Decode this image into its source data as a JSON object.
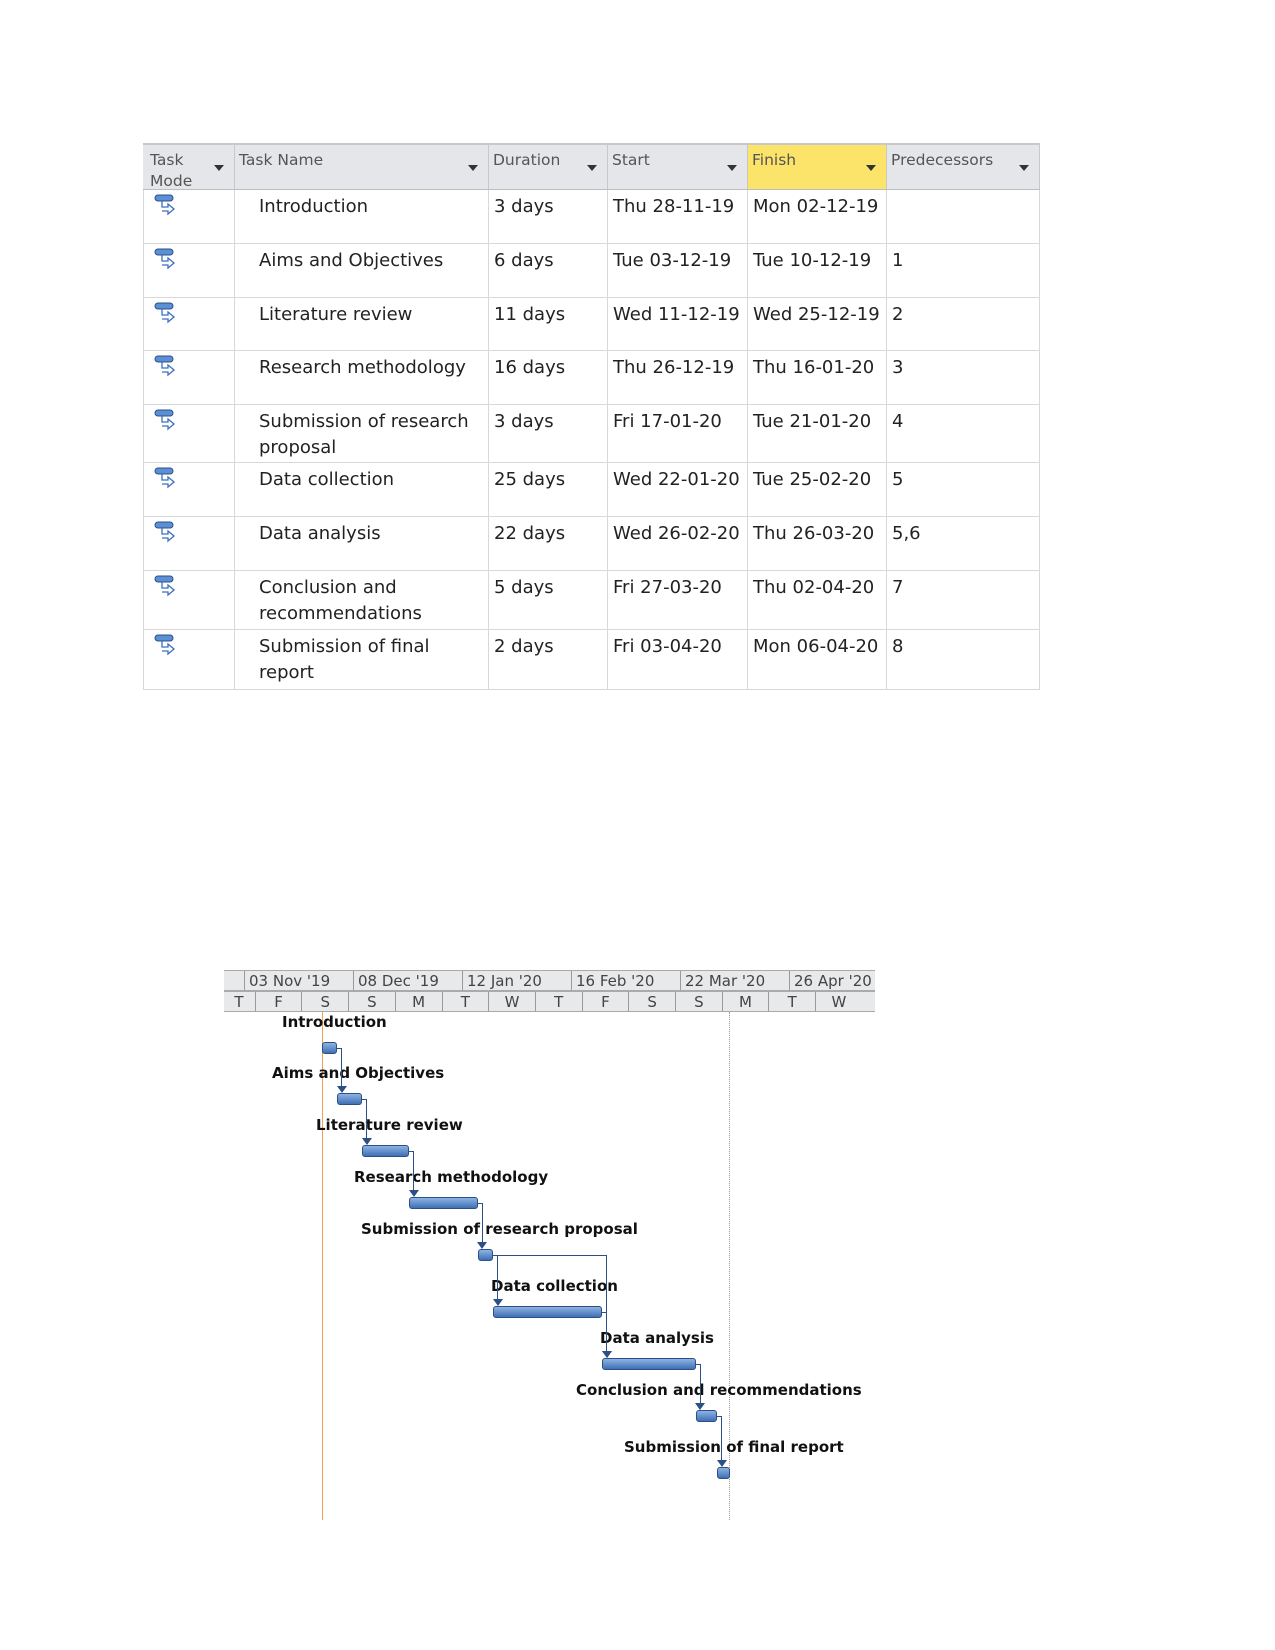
{
  "table": {
    "columns": [
      "Task Mode",
      "Task Name",
      "Duration",
      "Start",
      "Finish",
      "Predecessors"
    ],
    "column_mode_line1": "Task",
    "column_mode_line2": "Mode",
    "rows": [
      {
        "name": "Introduction",
        "duration": "3 days",
        "start": "Thu 28-11-19",
        "finish": "Mon 02-12-19",
        "pred": ""
      },
      {
        "name": "Aims and Objectives",
        "duration": "6 days",
        "start": "Tue 03-12-19",
        "finish": "Tue 10-12-19",
        "pred": "1"
      },
      {
        "name": "Literature review",
        "duration": "11 days",
        "start": "Wed 11-12-19",
        "finish": "Wed 25-12-19",
        "pred": "2"
      },
      {
        "name": "Research methodology",
        "duration": "16 days",
        "start": "Thu 26-12-19",
        "finish": "Thu 16-01-20",
        "pred": "3"
      },
      {
        "name": "Submission of research proposal",
        "duration": "3 days",
        "start": "Fri 17-01-20",
        "finish": "Tue 21-01-20",
        "pred": "4"
      },
      {
        "name": "Data collection",
        "duration": "25 days",
        "start": "Wed 22-01-20",
        "finish": "Tue 25-02-20",
        "pred": "5"
      },
      {
        "name": "Data analysis",
        "duration": "22 days",
        "start": "Wed 26-02-20",
        "finish": "Thu 26-03-20",
        "pred": "5,6"
      },
      {
        "name": "Conclusion and recommendations",
        "duration": "5 days",
        "start": "Fri 27-03-20",
        "finish": "Thu 02-04-20",
        "pred": "7"
      },
      {
        "name": "Submission of final report",
        "duration": "2 days",
        "start": "Fri 03-04-20",
        "finish": "Mon 06-04-20",
        "pred": "8"
      }
    ],
    "task_mode_icon": "auto-scheduled-task-icon",
    "highlight_color": "#fce46a"
  },
  "gantt": {
    "major_ticks": [
      "03 Nov '19",
      "08 Dec '19",
      "12 Jan '20",
      "16 Feb '20",
      "22 Mar '20",
      "26 Apr '20"
    ],
    "minor_ticks": [
      "T",
      "F",
      "S",
      "S",
      "M",
      "T",
      "W",
      "T",
      "F",
      "S",
      "S",
      "M",
      "T",
      "W"
    ],
    "bar_color": "#4f81bd",
    "current_date_line_color": "#f0a050"
  }
}
